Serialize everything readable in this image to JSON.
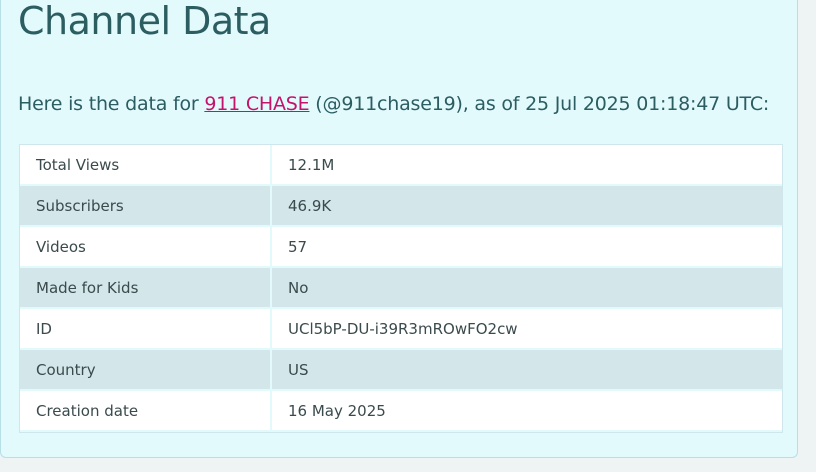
{
  "page": {
    "title": "Channel Data",
    "intro": {
      "prefix": "Here is the data for ",
      "channel_link": "911 CHASE",
      "suffix": " (@911chase19), as of 25 Jul 2025 01:18:47 UTC:"
    }
  },
  "table": {
    "rows": [
      {
        "label": "Total Views",
        "value": "12.1M"
      },
      {
        "label": "Subscribers",
        "value": "46.9K"
      },
      {
        "label": "Videos",
        "value": "57"
      },
      {
        "label": "Made for Kids",
        "value": "No"
      },
      {
        "label": "ID",
        "value": "UCl5bP-DU-i39R3mROwFO2cw"
      },
      {
        "label": "Country",
        "value": "US"
      },
      {
        "label": "Creation date",
        "value": "16 May 2025"
      }
    ]
  },
  "colors": {
    "title": "#2b5d61",
    "link": "#c4136a",
    "card_background": "#e3fafd",
    "row_odd": "#ffffff",
    "row_even": "#d3e6ea"
  }
}
